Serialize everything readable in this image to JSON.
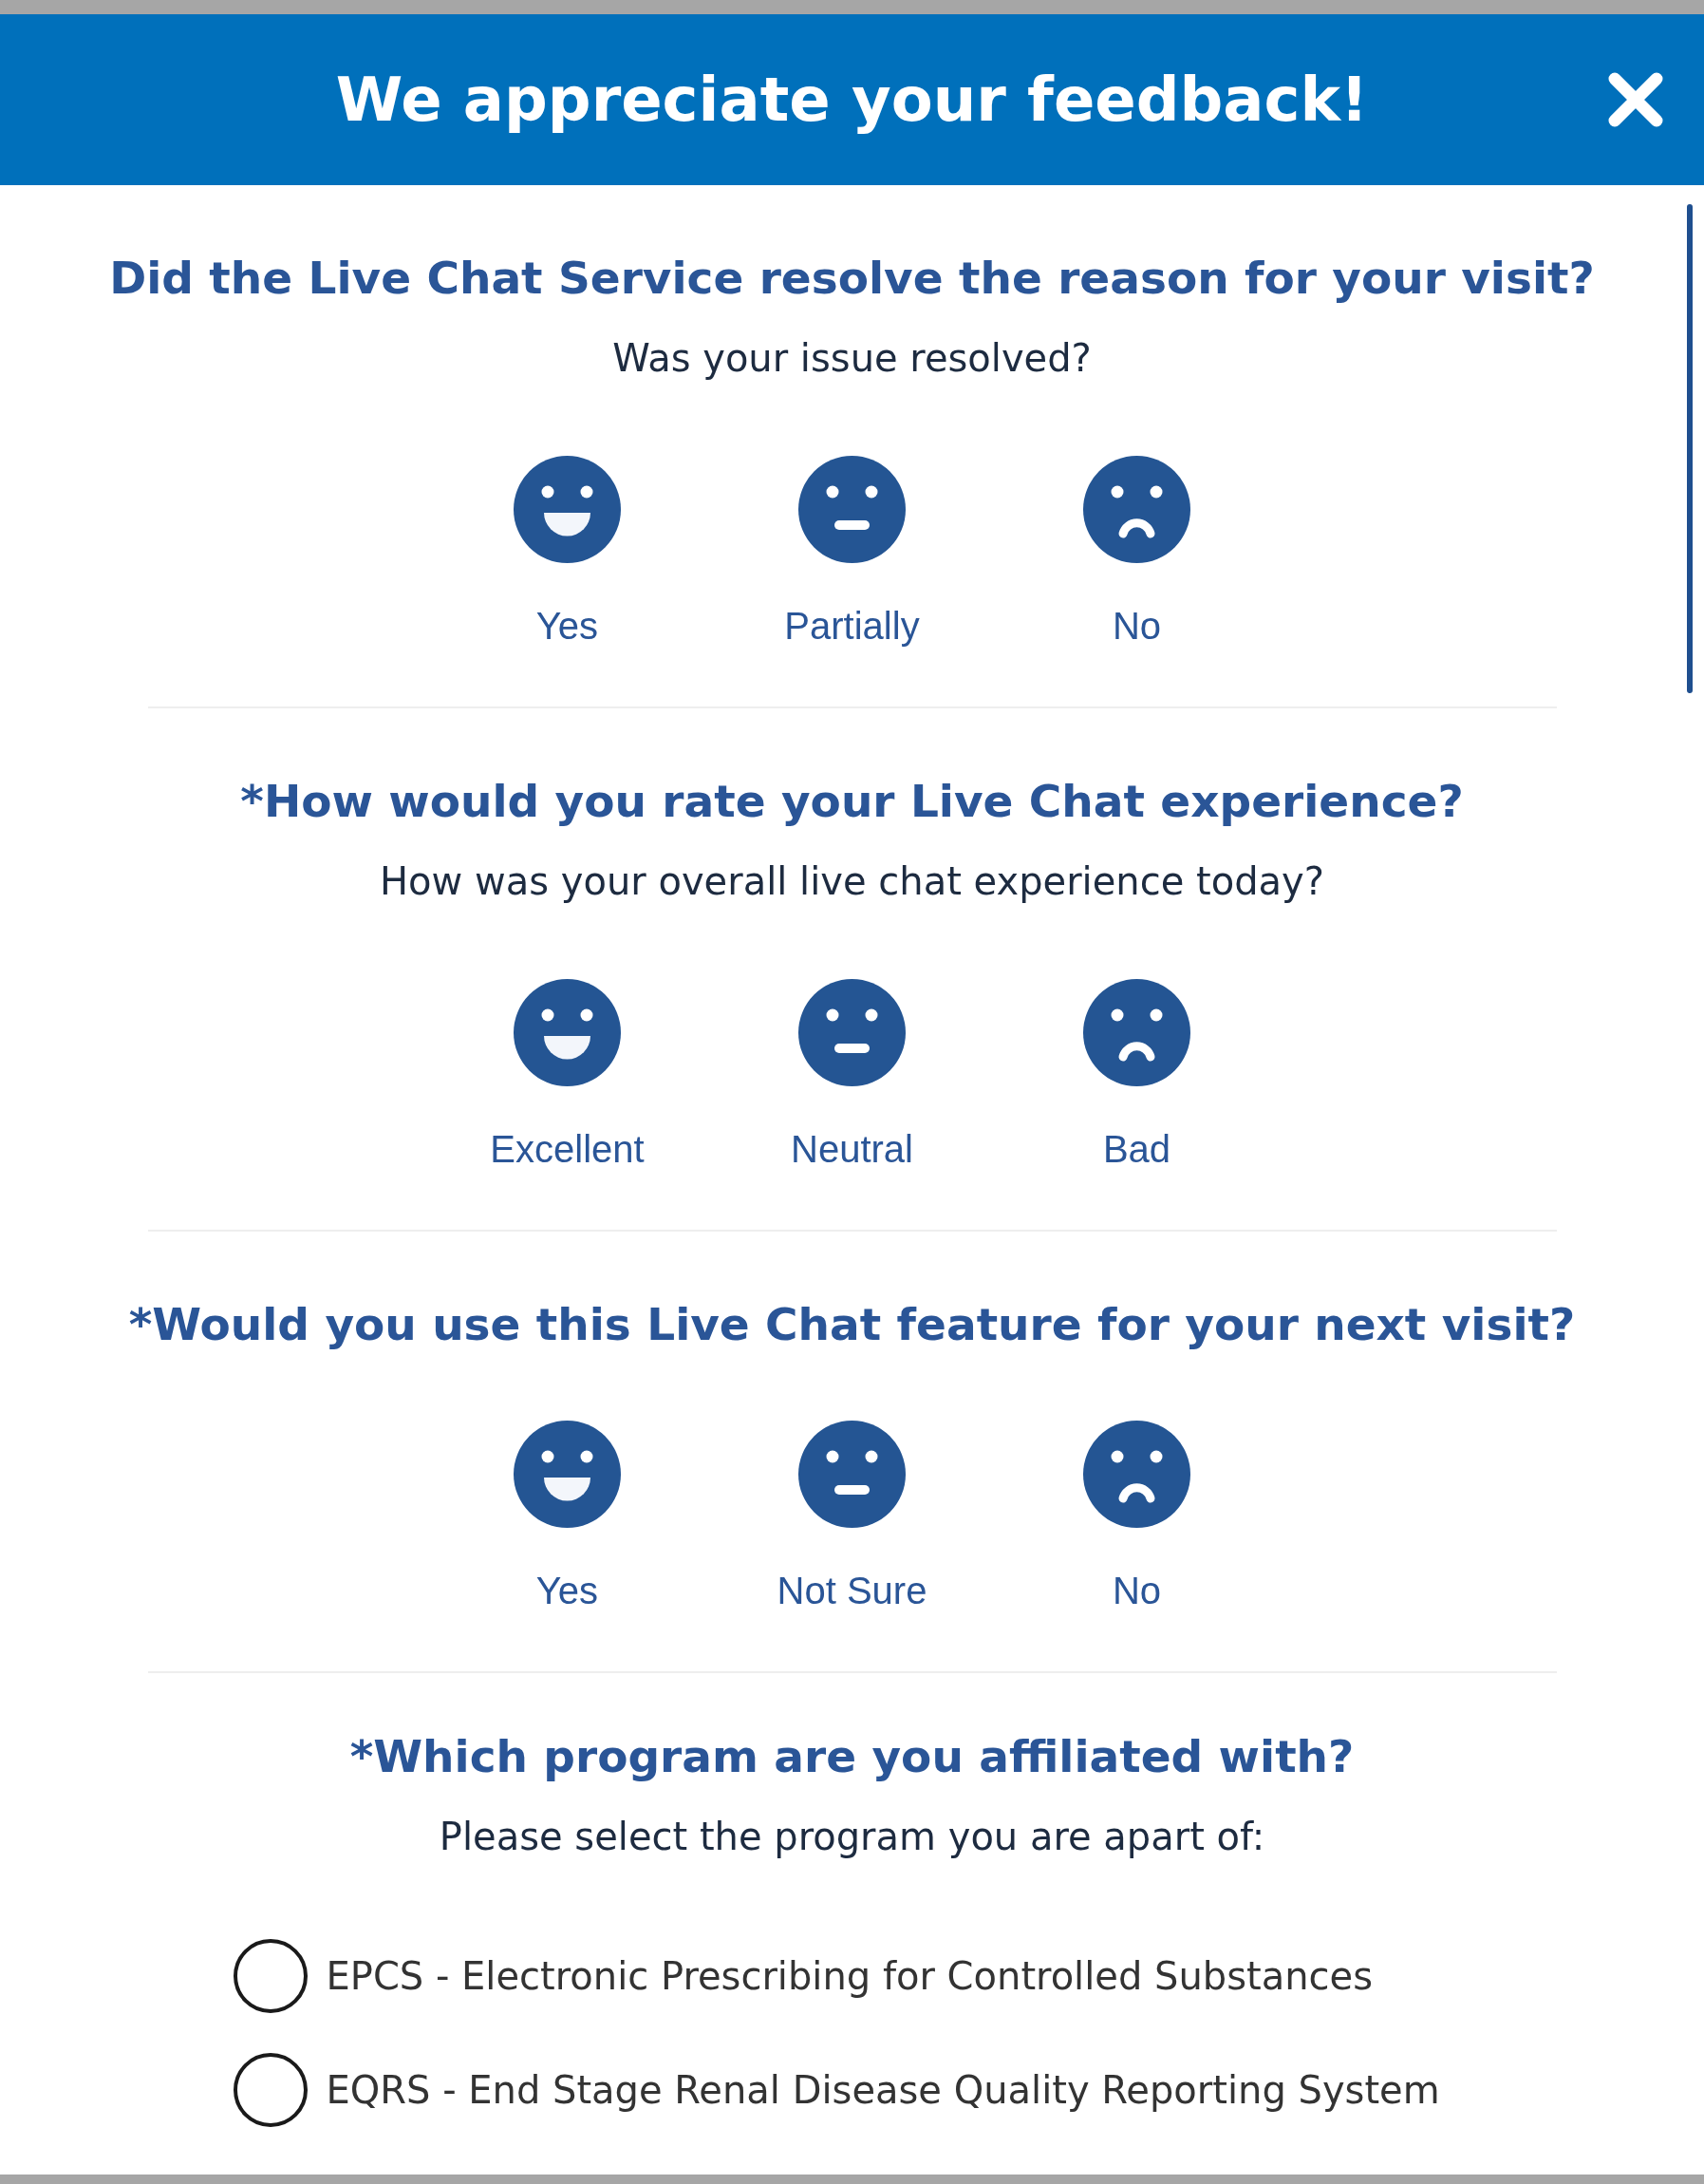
{
  "dialog": {
    "title": "We appreciate your feedback!"
  },
  "sections": [
    {
      "kind": "faces",
      "heading": "Did the Live Chat Service resolve the reason for your visit?",
      "subtitle": "Was your issue resolved?",
      "options": [
        {
          "kind": "happy",
          "label": "Yes"
        },
        {
          "kind": "neutral",
          "label": "Partially"
        },
        {
          "kind": "sad",
          "label": "No"
        }
      ]
    },
    {
      "kind": "faces",
      "heading": "*How would you rate your Live Chat experience?",
      "subtitle": "How was your overall live chat experience today?",
      "options": [
        {
          "kind": "happy",
          "label": "Excellent"
        },
        {
          "kind": "neutral",
          "label": "Neutral"
        },
        {
          "kind": "sad",
          "label": "Bad"
        }
      ]
    },
    {
      "kind": "faces",
      "heading": "*Would you use this Live Chat feature for your next visit?",
      "options": [
        {
          "kind": "happy",
          "label": "Yes"
        },
        {
          "kind": "neutral",
          "label": "Not Sure"
        },
        {
          "kind": "sad",
          "label": "No"
        }
      ]
    },
    {
      "kind": "radios",
      "heading": "*Which program are you affiliated with?",
      "subtitle": "Please select the program you are apart of:",
      "options": [
        {
          "label": "EPCS - Electronic Prescribing for Controlled Substances",
          "selected": false
        },
        {
          "label": "EQRS - End Stage Renal Disease Quality Reporting System",
          "selected": false
        }
      ]
    }
  ]
}
